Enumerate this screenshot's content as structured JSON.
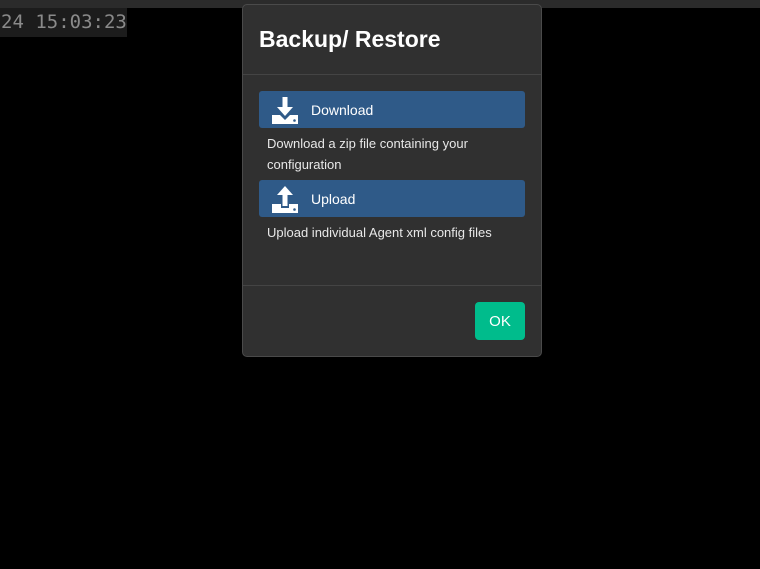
{
  "background": {
    "timestamp": "24 15:03:23"
  },
  "modal": {
    "title": "Backup/ Restore",
    "download": {
      "label": "Download",
      "icon": "download-icon",
      "description": "Download a zip file containing your configuration"
    },
    "upload": {
      "label": "Upload",
      "icon": "upload-icon",
      "description": "Upload individual Agent xml config files"
    },
    "ok_label": "OK"
  },
  "colors": {
    "action_button": "#2f5a88",
    "ok_button": "#00bc8c",
    "modal_bg": "#303030"
  }
}
